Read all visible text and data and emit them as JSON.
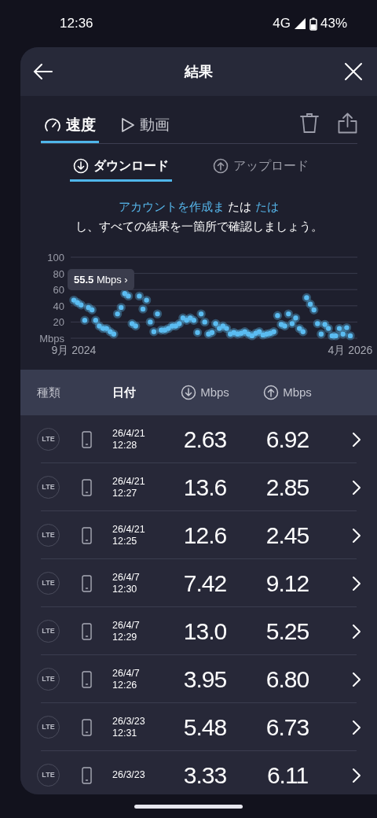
{
  "status_bar": {
    "time": "12:36",
    "network": "4G",
    "battery": "43%"
  },
  "header": {
    "title": "結果"
  },
  "tabs": [
    {
      "label": "速度",
      "selected": true,
      "kind": "speed"
    },
    {
      "label": "動画",
      "selected": false,
      "kind": "video"
    }
  ],
  "subtabs": [
    {
      "label": "ダウンロード",
      "selected": true,
      "kind": "down"
    },
    {
      "label": "アップロード",
      "selected": false,
      "kind": "up"
    }
  ],
  "message": {
    "parts": [
      {
        "text": "アカウントを作成ま",
        "kind": "link"
      },
      {
        "text": " たは ",
        "kind": "plain"
      },
      {
        "text": "たは",
        "kind": "link"
      },
      {
        "text": "し、すべての結果を一箇所で確認しましょう。",
        "kind": "line"
      }
    ]
  },
  "chart": {
    "tooltip": "**55.5** Mbps ›",
    "chart_data": {
      "type": "scatter",
      "grid": true,
      "ylim": [
        0,
        100
      ],
      "yticks": [
        {
          "value": 0,
          "label": "Mbps"
        },
        20,
        40,
        60,
        80,
        100
      ],
      "categories": [
        "9月 2024",
        null,
        null,
        null,
        null,
        null,
        null,
        null,
        null,
        null,
        null,
        null,
        null,
        null,
        null,
        null,
        null,
        null,
        null,
        null,
        null,
        null,
        null,
        null,
        null,
        null,
        null,
        null,
        null,
        null,
        null,
        null,
        null,
        null,
        null,
        null,
        null,
        null,
        null,
        null,
        null,
        null,
        null,
        null,
        null,
        null,
        null,
        null,
        null,
        null,
        null,
        null,
        null,
        null,
        null,
        null,
        null,
        null,
        null,
        null,
        null,
        null,
        null,
        null,
        null,
        null,
        null,
        null,
        null,
        null,
        null,
        null,
        null,
        null,
        null,
        null,
        "4月 2026"
      ],
      "series": [
        {
          "color": "#5bbcf2",
          "values": [
            47,
            44,
            41,
            22,
            38,
            35,
            22,
            15,
            12,
            12,
            8,
            5,
            30,
            38,
            55,
            52,
            18,
            15,
            52,
            36,
            47,
            20,
            8,
            30,
            10,
            10,
            12,
            15,
            15,
            18,
            25,
            22,
            25,
            22,
            7,
            30,
            20,
            5,
            7,
            18,
            12,
            15,
            12,
            5,
            7,
            5,
            6,
            8,
            5,
            3,
            6,
            8,
            4,
            5,
            6,
            8,
            28,
            17,
            15,
            30,
            18,
            25,
            12,
            8,
            50,
            42,
            35,
            18,
            5,
            17,
            12,
            3,
            3,
            12,
            5,
            13,
            3
          ]
        }
      ]
    }
  },
  "table": {
    "columns": [
      {
        "label": "種類",
        "sorted": false,
        "kind": "text"
      },
      {
        "label": "日付",
        "sorted": true,
        "kind": "text"
      },
      {
        "label": "Mbps",
        "sorted": false,
        "kind": "down"
      },
      {
        "label": "Mbps",
        "sorted": false,
        "kind": "up"
      }
    ],
    "rows": [
      {
        "type": "LTE",
        "date": "26/4/21",
        "time": "12:28",
        "download": "2.63",
        "upload": "6.92"
      },
      {
        "type": "LTE",
        "date": "26/4/21",
        "time": "12:27",
        "download": "13.6",
        "upload": "2.85"
      },
      {
        "type": "LTE",
        "date": "26/4/21",
        "time": "12:25",
        "download": "12.6",
        "upload": "2.45"
      },
      {
        "type": "LTE",
        "date": "26/4/7",
        "time": "12:30",
        "download": "7.42",
        "upload": "9.12"
      },
      {
        "type": "LTE",
        "date": "26/4/7",
        "time": "12:29",
        "download": "13.0",
        "upload": "5.25"
      },
      {
        "type": "LTE",
        "date": "26/4/7",
        "time": "12:26",
        "download": "3.95",
        "upload": "6.80"
      },
      {
        "type": "LTE",
        "date": "26/3/23",
        "time": "12:31",
        "download": "5.48",
        "upload": "6.73"
      },
      {
        "type": "LTE",
        "date": "26/3/23",
        "download": "3.33",
        "upload": "6.11"
      }
    ]
  }
}
